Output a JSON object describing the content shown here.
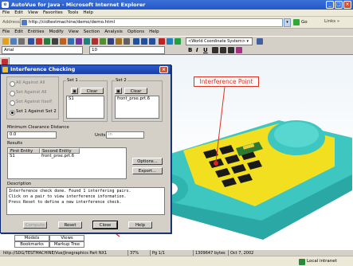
{
  "ie": {
    "title": "AutoVue for Java - Microsoft Internet Explorer",
    "menu": [
      "File",
      "Edit",
      "View",
      "Favorites",
      "Tools",
      "Help"
    ],
    "address_label": "Address",
    "address_url": "http://cidtestmachine/demo/demo.html",
    "go_label": "Go",
    "links_label": "Links",
    "status_zone": "Local intranet"
  },
  "app": {
    "menu": [
      "File",
      "Edit",
      "Entities",
      "Modify",
      "View",
      "Section",
      "Analysis",
      "Options",
      "Help"
    ],
    "coord_system": "<World Coordinate System>",
    "font_name": "Arial",
    "font_size": "10",
    "format_buttons": [
      "B",
      "I",
      "U"
    ]
  },
  "annotation": {
    "label": "Interference Point",
    "color": "#e03020"
  },
  "dialog": {
    "title": "Interference Checking",
    "radios": [
      "All Against All",
      "Set Against All",
      "Set Against Itself",
      "Set 1 Against Set 2"
    ],
    "selected_radio_index": 3,
    "set1": {
      "label": "Set 1",
      "clear": "Clear",
      "item": "S1"
    },
    "set2": {
      "label": "Set 2",
      "clear": "Clear",
      "item": "front_prse.prt.6"
    },
    "min_clearance_label": "Minimum Clearance Distance",
    "min_clearance_value": "0.0",
    "units_label": "Units:",
    "units_value": "in",
    "results_label": "Results",
    "results_headers": [
      "First Entity",
      "Second Entity"
    ],
    "results_rows": [
      [
        "S1",
        "front_prse.prt.6"
      ]
    ],
    "options_button": "Options...",
    "export_button": "Export...",
    "description_label": "Description",
    "description_text": "Interference check done. Found 1 interfering pairs.\nClick on a pair to view interference information.\nPress Reset to define a new interference check.",
    "buttons": {
      "compute": "Compute",
      "reset": "Reset",
      "close": "Close",
      "help": "Help"
    }
  },
  "bottom_tabs": {
    "row1": [
      "Models",
      "Views"
    ],
    "row2": [
      "Bookmarks",
      "Markup Tree"
    ]
  },
  "statusbar": {
    "path": "http://SDG/TESTMACHINE/Vue/Jinegraphics Part NX1",
    "zoom": "37%",
    "page": "Pg 1/1",
    "size": "1309647 bytes",
    "date": "Oct 7, 2002"
  },
  "colors": {
    "xp_blue": "#2457c6",
    "model_teal": "#3ec6c0",
    "model_yellow": "#f2e020",
    "model_black": "#1a1a1a"
  }
}
